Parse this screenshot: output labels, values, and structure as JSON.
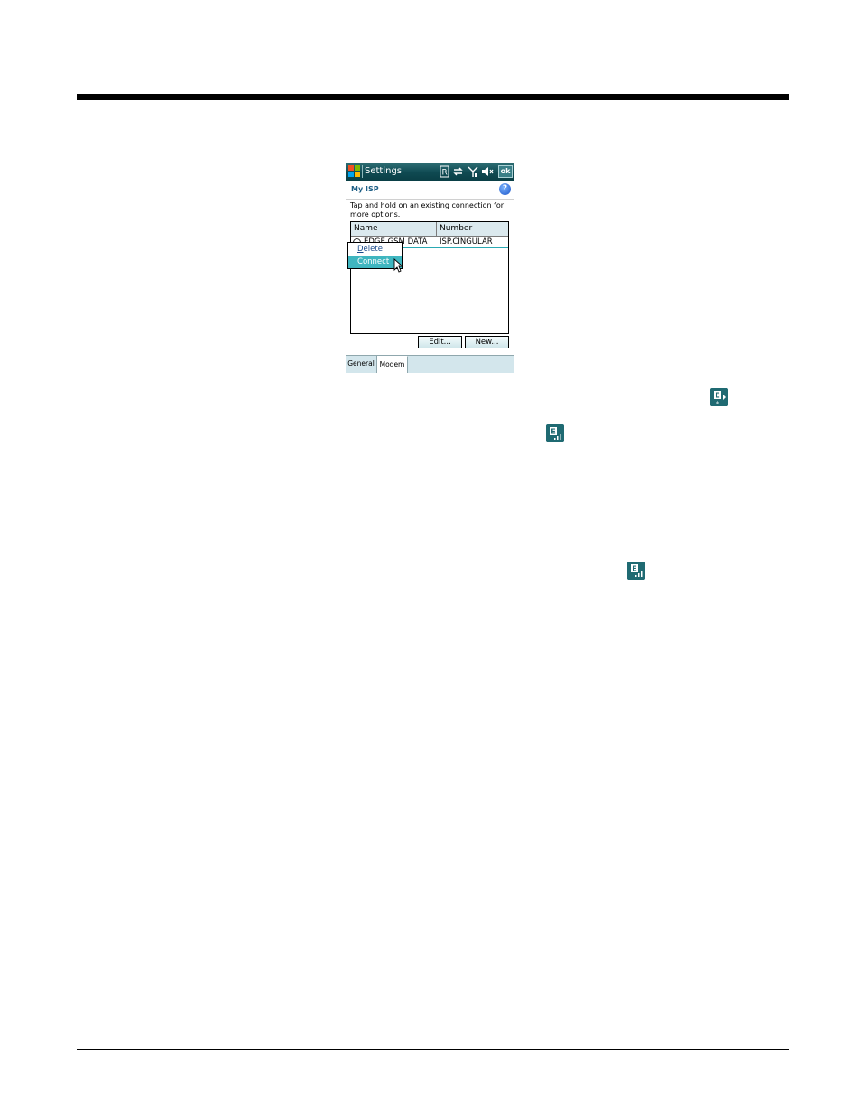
{
  "window": {
    "title": "Settings",
    "ok_label": "ok"
  },
  "status_icons": [
    "roaming-icon",
    "data-connection-icon",
    "signal-icon",
    "volume-muted-icon"
  ],
  "page": {
    "heading": "My ISP",
    "instructions": "Tap and hold on an existing connection for more options."
  },
  "table": {
    "columns": [
      "Name",
      "Number"
    ],
    "rows": [
      {
        "name": "EDGE GSM DATA",
        "number": "ISP.CINGULAR"
      }
    ]
  },
  "context_menu": {
    "items": [
      {
        "label": "Delete",
        "accel": "D",
        "rest": "elete"
      },
      {
        "label": "Connect",
        "accel": "C",
        "rest": "onnect"
      }
    ]
  },
  "buttons": {
    "edit": "Edit...",
    "new": "New..."
  },
  "tabs": [
    "General",
    "Modem"
  ],
  "colors": {
    "titlebar": "#0f4a52",
    "highlight": "#3fb6c0",
    "heading": "#1d5f86"
  }
}
